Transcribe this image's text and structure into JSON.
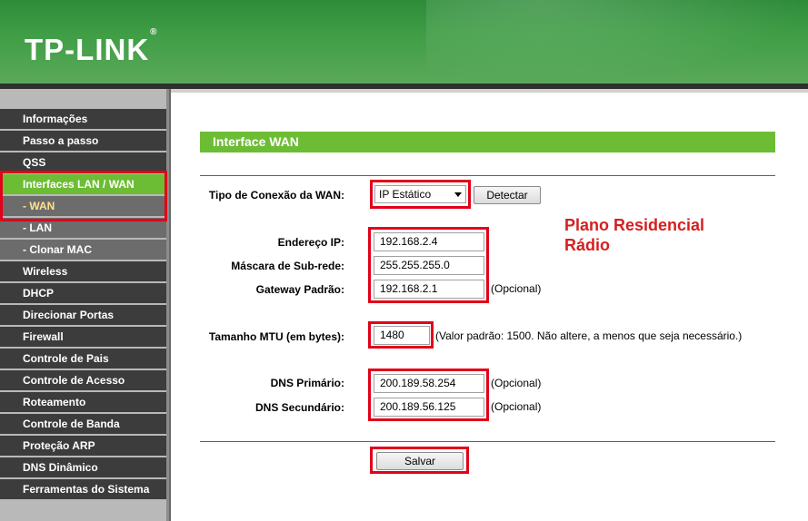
{
  "header": {
    "logo_text": "TP-LINK",
    "logo_mark": "®"
  },
  "sidebar": {
    "items": [
      {
        "label": "Informações"
      },
      {
        "label": "Passo a passo"
      },
      {
        "label": "QSS"
      },
      {
        "label": "Interfaces LAN / WAN"
      },
      {
        "label": "- WAN"
      },
      {
        "label": "- LAN"
      },
      {
        "label": "- Clonar MAC"
      },
      {
        "label": "Wireless"
      },
      {
        "label": "DHCP"
      },
      {
        "label": "Direcionar Portas"
      },
      {
        "label": "Firewall"
      },
      {
        "label": "Controle de Pais"
      },
      {
        "label": "Controle de Acesso"
      },
      {
        "label": "Roteamento"
      },
      {
        "label": "Controle de Banda"
      },
      {
        "label": "Proteção ARP"
      },
      {
        "label": "DNS Dinâmico"
      },
      {
        "label": "Ferramentas do Sistema"
      }
    ]
  },
  "main": {
    "title": "Interface WAN",
    "wan_type": {
      "label": "Tipo de Conexão da WAN:",
      "value": "IP Estático",
      "detect_button": "Detectar"
    },
    "ip": {
      "label": "Endereço IP:",
      "value": "192.168.2.4"
    },
    "mask": {
      "label": "Máscara de Sub-rede:",
      "value": "255.255.255.0"
    },
    "gateway": {
      "label": "Gateway Padrão:",
      "value": "192.168.2.1",
      "note": "(Opcional)"
    },
    "mtu": {
      "label": "Tamanho MTU (em bytes):",
      "value": "1480",
      "note": "(Valor padrão: 1500. Não altere, a menos que seja necessário.)"
    },
    "dns1": {
      "label": "DNS Primário:",
      "value": "200.189.58.254",
      "note": "(Opcional)"
    },
    "dns2": {
      "label": "DNS Secundário:",
      "value": "200.189.56.125",
      "note": "(Opcional)"
    },
    "save_button": "Salvar",
    "annotation_line1": "Plano Residencial",
    "annotation_line2": "Rádio"
  },
  "colors": {
    "accent_green": "#6dbd34",
    "highlight_red": "#e2001a",
    "annotation_red": "#d42020"
  }
}
